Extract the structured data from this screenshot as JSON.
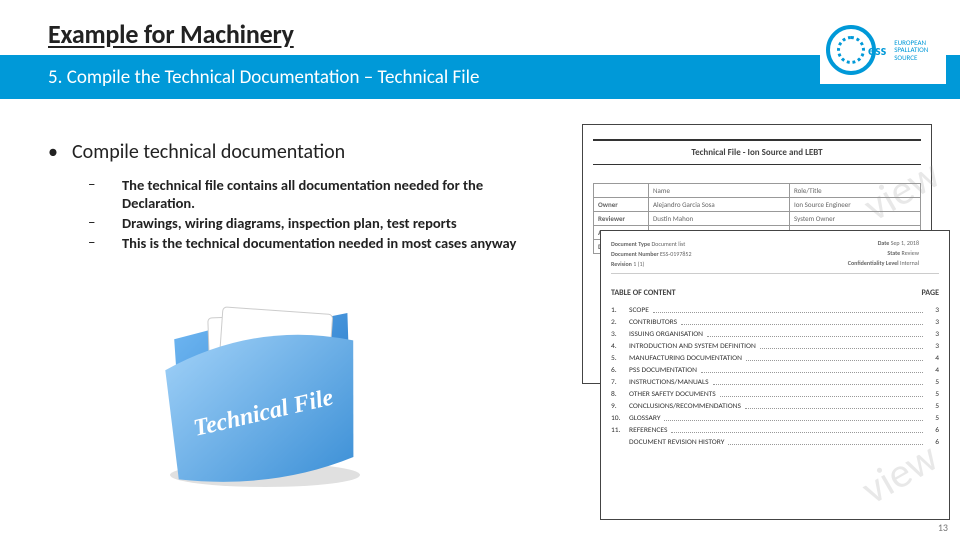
{
  "header": {
    "title": "Example for Machinery",
    "subtitle": "5. Compile the Technical Documentation – Technical File"
  },
  "logo": {
    "abbr": "ess",
    "line1": "EUROPEAN",
    "line2": "SPALLATION",
    "line3": "SOURCE"
  },
  "bullet": {
    "marker": "•",
    "text": "Compile technical documentation"
  },
  "subs": [
    {
      "dash": "–",
      "text": "The technical file contains all documentation needed for the Declaration."
    },
    {
      "dash": "–",
      "text": "Drawings, wiring diagrams, inspection plan, test reports"
    },
    {
      "dash": "–",
      "text": "This is the technical documentation needed in most cases anyway"
    }
  ],
  "folder": {
    "label": "Technical File"
  },
  "doc_back": {
    "title": "Technical File - Ion Source and LEBT",
    "rows": [
      {
        "label": "Owner",
        "name": "Alejandro Garcia Sosa",
        "role": "Ion Source Engineer"
      },
      {
        "label": "Reviewer",
        "name": "Dustin Mahon",
        "role": "System Owner"
      },
      {
        "label": "Approver",
        "name": "",
        "role": ""
      },
      {
        "label": "Distribution",
        "name": "",
        "role": ""
      }
    ],
    "headers": {
      "name": "Name",
      "role": "Role/Title"
    },
    "watermark": "view"
  },
  "doc_front": {
    "meta": [
      {
        "k": "Document Type",
        "v": "Document list"
      },
      {
        "k": "Document Number",
        "v": "ESS-0197852"
      },
      {
        "k": "Revision",
        "v": "1 (1)"
      },
      {
        "k": "Date",
        "v": "Sep 1, 2018"
      },
      {
        "k": "State",
        "v": "Review"
      },
      {
        "k": "Confidentiality Level",
        "v": "Internal"
      }
    ],
    "toc_head": {
      "left": "TABLE OF CONTENT",
      "right": "PAGE"
    },
    "toc": [
      {
        "n": "1.",
        "t": "SCOPE",
        "p": "3"
      },
      {
        "n": "2.",
        "t": "CONTRIBUTORS",
        "p": "3"
      },
      {
        "n": "3.",
        "t": "ISSUING ORGANISATION",
        "p": "3"
      },
      {
        "n": "4.",
        "t": "INTRODUCTION AND SYSTEM DEFINITION",
        "p": "3"
      },
      {
        "n": "5.",
        "t": "MANUFACTURING DOCUMENTATION",
        "p": "4"
      },
      {
        "n": "6.",
        "t": "PSS DOCUMENTATION",
        "p": "4"
      },
      {
        "n": "7.",
        "t": "INSTRUCTIONS/MANUALS",
        "p": "5"
      },
      {
        "n": "8.",
        "t": "OTHER SAFETY DOCUMENTS",
        "p": "5"
      },
      {
        "n": "9.",
        "t": "CONCLUSIONS/RECOMMENDATIONS",
        "p": "5"
      },
      {
        "n": "10.",
        "t": "GLOSSARY",
        "p": "5"
      },
      {
        "n": "11.",
        "t": "REFERENCES",
        "p": "6"
      },
      {
        "n": "",
        "t": "DOCUMENT REVISION HISTORY",
        "p": "6"
      }
    ],
    "watermark": "view"
  },
  "pagenum": "13"
}
